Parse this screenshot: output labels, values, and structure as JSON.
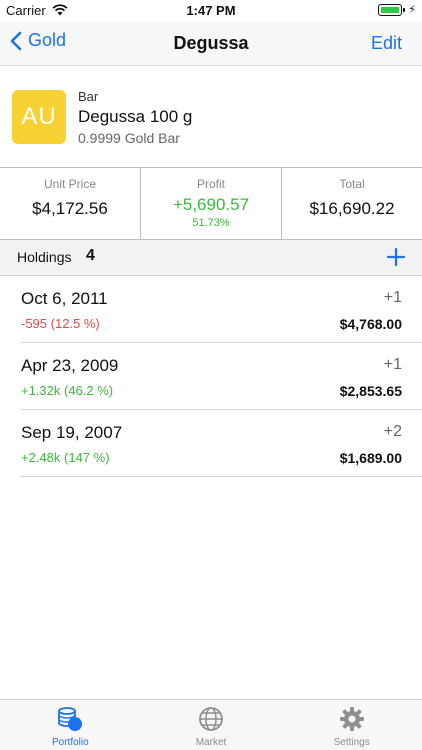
{
  "status_bar": {
    "carrier": "Carrier",
    "time": "1:47 PM"
  },
  "nav": {
    "back_label": "Gold",
    "title": "Degussa",
    "edit_label": "Edit"
  },
  "product": {
    "badge": "AU",
    "type": "Bar",
    "name": "Degussa 100 g",
    "description": "0.9999 Gold Bar"
  },
  "summary": {
    "unit_price_label": "Unit Price",
    "unit_price_value": "$4,172.56",
    "profit_label": "Profit",
    "profit_value": "+5,690.57",
    "profit_percent": "51.73%",
    "total_label": "Total",
    "total_value": "$16,690.22"
  },
  "holdings": {
    "label": "Holdings",
    "count": "4",
    "rows": [
      {
        "date": "Oct 6, 2011",
        "change": "-595 (12.5 %)",
        "change_color": "#e14a4a",
        "qty": "+1",
        "price": "$4,768.00"
      },
      {
        "date": "Apr 23, 2009",
        "change": "+1.32k (46.2 %)",
        "change_color": "#3cb83c",
        "qty": "+1",
        "price": "$2,853.65"
      },
      {
        "date": "Sep 19, 2007",
        "change": "+2.48k (147 %)",
        "change_color": "#3cb83c",
        "qty": "+2",
        "price": "$1,689.00"
      }
    ]
  },
  "tabs": [
    {
      "label": "Portfolio",
      "icon": "coins-icon",
      "active": true
    },
    {
      "label": "Market",
      "icon": "globe-icon",
      "active": false
    },
    {
      "label": "Settings",
      "icon": "gear-icon",
      "active": false
    }
  ],
  "colors": {
    "accent": "#1a73e8",
    "gold": "#f8d233",
    "positive": "#3cb83c",
    "negative": "#e14a4a"
  }
}
